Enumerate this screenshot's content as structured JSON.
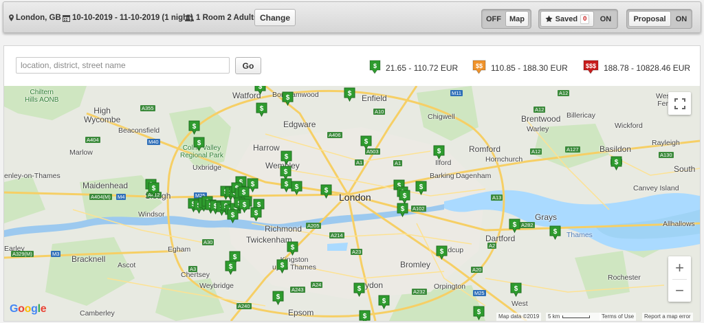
{
  "topbar": {
    "location": "London, GB",
    "dates": "10-10-2019 - 11-10-2019 (1 night)",
    "guests": "1 Room 2 Adults",
    "change_label": "Change",
    "map_toggle": {
      "off_label": "OFF",
      "on_label": "Map",
      "state": "on"
    },
    "saved_toggle": {
      "label": "Saved",
      "count": "0",
      "state_label": "ON"
    },
    "proposal_toggle": {
      "label": "Proposal",
      "state_label": "ON"
    }
  },
  "search": {
    "placeholder": "location, district, street name",
    "value": "",
    "go_label": "Go"
  },
  "price_legend": [
    {
      "symbol": "$",
      "range": "21.65 - 110.72 EUR",
      "color": "#2e9b2e"
    },
    {
      "symbol": "$$",
      "range": "110.85 - 188.30 EUR",
      "color": "#f0932b"
    },
    {
      "symbol": "$$$",
      "range": "188.78 - 10828.46 EUR",
      "color": "#c81d1d"
    }
  ],
  "map": {
    "places": {
      "watford": "Watford",
      "enfield": "Enfield",
      "high_wycombe": "High\nWycombe",
      "chiltern": "Chiltern\nHills AONB",
      "beaconsfield": "Beaconsfield",
      "edgware": "Edgware",
      "chigwell": "Chigwell",
      "billericay": "Billericay",
      "brentwood": "Brentwood",
      "warley": "Warley",
      "wickford": "Wickford",
      "rayleigh": "Rayleigh",
      "marlow": "Marlow",
      "colne": "Colne Valley\nRegional Park",
      "uxbridge": "Uxbridge",
      "harrow": "Harrow",
      "wembley": "Wembley",
      "romford": "Romford",
      "hornchurch": "Hornchurch",
      "basildon": "Basildon",
      "ilford": "Ilford",
      "henley": "enley-on-Thames",
      "maidenhead": "Maidenhead",
      "slough": "Slough",
      "london": "London",
      "barking": "Barking",
      "dagenham": "Dagenham",
      "canvey": "Canvey Island",
      "southend": "South",
      "windsor": "Windsor",
      "richmond": "Richmond",
      "grays": "Grays",
      "allhallows": "Allhallows",
      "twickenham": "Twickenham",
      "egham": "Egham",
      "dartford": "Dartford",
      "thames": "Thames",
      "earley": "Earley",
      "kingston": "Kingston\nupon Thames",
      "bracknell": "Bracknell",
      "ascot": "Ascot",
      "bromley": "Bromley",
      "sidcup": "idcup",
      "chertsey": "Chertsey",
      "weybridge": "Weybridge",
      "orpington": "Orpington",
      "rochester": "Rochester",
      "croydon": "ydon",
      "west": "West",
      "epsom": "Epsom",
      "camberley": "Camberley",
      "borehamwood": "Borehamwood",
      "westoff": "West\nFerr"
    },
    "roads": [
      "A355",
      "M40",
      "A404",
      "A404(M)",
      "M4",
      "A412",
      "M25",
      "A30",
      "A329(M)",
      "M3",
      "A3",
      "A240",
      "A243",
      "A24",
      "A214",
      "A205",
      "A23",
      "A232",
      "M25",
      "A20",
      "A2",
      "A282",
      "A13",
      "A102",
      "A12",
      "A127",
      "A13",
      "A130",
      "A10",
      "A1",
      "A503",
      "A406",
      "M11",
      "A12",
      "A1",
      "A12"
    ],
    "attribution": {
      "data": "Map data ©2019",
      "scale": "5 km",
      "terms": "Terms of Use",
      "report": "Report a map error"
    },
    "google_logo": "Google",
    "fullscreen": "fullscreen",
    "zoom_in": "+",
    "zoom_out": "−",
    "pin_symbol": "$",
    "pin_color": "#2e9b2e",
    "pin_count": 60
  }
}
